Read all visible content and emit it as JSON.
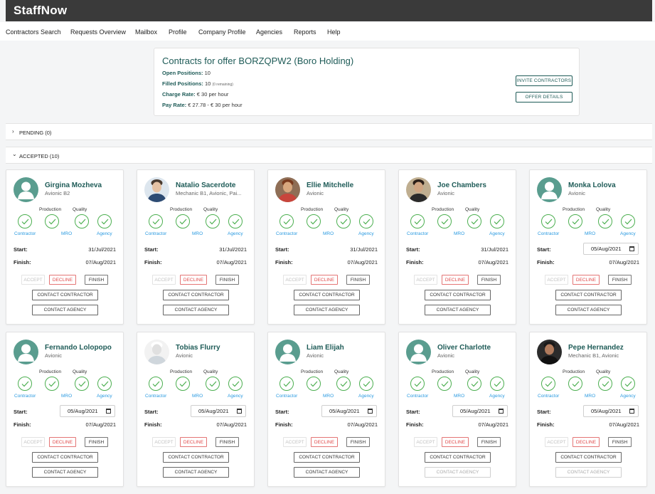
{
  "app": {
    "logo": "StaffNow"
  },
  "nav": [
    "Contractors Search",
    "Requests Overview",
    "Mailbox",
    "Profile",
    "Company Profile",
    "Agencies",
    "Reports",
    "Help"
  ],
  "offer": {
    "title": "Contracts for offer BORZQPW2 (Boro Holding)",
    "open_label": "Open Positions:",
    "open_value": "10",
    "filled_label": "Filled Positions:",
    "filled_value": "10",
    "filled_note": "(0 remaining)",
    "charge_label": "Charge Rate:",
    "charge_value": "€ 30 per hour",
    "pay_label": "Pay Rate:",
    "pay_value": "€ 27.78 - € 30  per hour",
    "invite_button": "INVITE CONTRACTORS",
    "details_button": "OFFER DETAILS"
  },
  "sections": {
    "pending": "PENDING (0)",
    "accepted": "ACCEPTED (10)"
  },
  "labels": {
    "production": "Production",
    "quality": "Quality",
    "contractor": "Contractor",
    "mro": "MRO",
    "agency": "Agency",
    "start": "Start:",
    "finish": "Finish:",
    "accept": "ACCEPT",
    "decline": "DECLINE",
    "finish_btn": "FINISH",
    "contact_contractor": "CONTACT CONTRACTOR",
    "contact_agency": "CONTACT AGENCY"
  },
  "colors": {
    "brand": "#1e5b57",
    "check": "#4caf50",
    "decline": "#e04848",
    "link": "#2a9ae0",
    "topbar": "#3a3a3a"
  },
  "contracts": [
    {
      "name": "Girgina Mozheva",
      "role": "Avionic B2",
      "avatar": "default-avatar",
      "start": "31/Jul/2021",
      "finish": "07/Aug/2021",
      "start_editable": false,
      "agency_enabled": true
    },
    {
      "name": "Natalio Sacerdote",
      "role": "Mechanic B1, Avionic, Pai...",
      "avatar": "photo-man-blue",
      "start": "31/Jul/2021",
      "finish": "07/Aug/2021",
      "start_editable": false,
      "agency_enabled": true
    },
    {
      "name": "Ellie Mitchelle",
      "role": "Avionic",
      "avatar": "photo-woman-red",
      "start": "31/Jul/2021",
      "finish": "07/Aug/2021",
      "start_editable": false,
      "agency_enabled": true
    },
    {
      "name": "Joe Chambers",
      "role": "Avionic",
      "avatar": "photo-man-dark",
      "start": "31/Jul/2021",
      "finish": "07/Aug/2021",
      "start_editable": false,
      "agency_enabled": true
    },
    {
      "name": "Monka Lolova",
      "role": "Avionic",
      "avatar": "default-avatar",
      "start": "05/Aug/2021",
      "finish": "07/Aug/2021",
      "start_editable": true,
      "agency_enabled": true
    },
    {
      "name": "Fernando Lolopopo",
      "role": "Avionic",
      "avatar": "default-avatar",
      "start": "05/Aug/2021",
      "finish": "07/Aug/2021",
      "start_editable": true,
      "agency_enabled": true
    },
    {
      "name": "Tobias Flurry",
      "role": "Avionic",
      "avatar": "photo-screenshot",
      "start": "05/Aug/2021",
      "finish": "07/Aug/2021",
      "start_editable": true,
      "agency_enabled": true
    },
    {
      "name": "Liam Elijah",
      "role": "Avionic",
      "avatar": "default-avatar",
      "start": "05/Aug/2021",
      "finish": "07/Aug/2021",
      "start_editable": true,
      "agency_enabled": true
    },
    {
      "name": "Oliver Charlotte",
      "role": "Avionic",
      "avatar": "default-avatar",
      "start": "05/Aug/2021",
      "finish": "07/Aug/2021",
      "start_editable": true,
      "agency_enabled": false
    },
    {
      "name": "Pepe Hernandez",
      "role": "Mechanic B1, Avionic",
      "avatar": "photo-man-black",
      "start": "05/Aug/2021",
      "finish": "07/Aug/2021",
      "start_editable": true,
      "agency_enabled": false
    }
  ]
}
